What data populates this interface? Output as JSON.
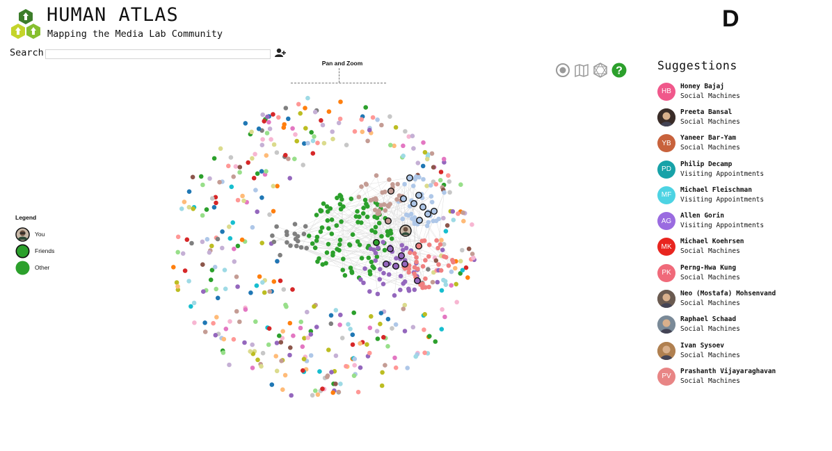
{
  "header": {
    "title": "HUMAN ATLAS",
    "subtitle": "Mapping the Media Lab Community",
    "brand_letter": "D"
  },
  "search": {
    "label": "Search",
    "value": "",
    "placeholder": ""
  },
  "panzoom": {
    "label": "Pan and Zoom"
  },
  "toolbar": {
    "icons": [
      "target-icon",
      "map-icon",
      "network-icon",
      "help-icon"
    ],
    "help_color": "#2ca02c"
  },
  "legend": {
    "title": "Legend",
    "items": [
      {
        "label": "You",
        "style": "photo"
      },
      {
        "label": "Friends",
        "color": "#2ca02c",
        "outline": true
      },
      {
        "label": "Other",
        "color": "#2ca02c",
        "outline": false
      }
    ]
  },
  "suggestions": {
    "title": "Suggestions",
    "items": [
      {
        "initials": "HB",
        "name": "Honey Bajaj",
        "group": "Social Machines",
        "color": "#f0588b",
        "photo": false
      },
      {
        "initials": "",
        "name": "Preeta Bansal",
        "group": "Social Machines",
        "color": "#3a2c28",
        "photo": true
      },
      {
        "initials": "YB",
        "name": "Yaneer Bar-Yam",
        "group": "Social Machines",
        "color": "#c8623c",
        "photo": false
      },
      {
        "initials": "PD",
        "name": "Philip Decamp",
        "group": "Visiting Appointments",
        "color": "#17a2a8",
        "photo": false
      },
      {
        "initials": "MF",
        "name": "Michael Fleischman",
        "group": "Visiting Appointments",
        "color": "#4dd3e3",
        "photo": false
      },
      {
        "initials": "AG",
        "name": "Allen Gorin",
        "group": "Visiting Appointments",
        "color": "#9a6be0",
        "photo": false
      },
      {
        "initials": "MK",
        "name": "Michael Koehrsen",
        "group": "Social Machines",
        "color": "#e8251f",
        "photo": false
      },
      {
        "initials": "PK",
        "name": "Perng-Hwa Kung",
        "group": "Social Machines",
        "color": "#f06a7a",
        "photo": false
      },
      {
        "initials": "",
        "name": "Neo (Mostafa) Mohsenvand",
        "group": "Social Machines",
        "color": "#6a5a50",
        "photo": true
      },
      {
        "initials": "",
        "name": "Raphael Schaad",
        "group": "Social Machines",
        "color": "#7a8a98",
        "photo": true
      },
      {
        "initials": "",
        "name": "Ivan Sysoev",
        "group": "Social Machines",
        "color": "#b08050",
        "photo": true
      },
      {
        "initials": "PV",
        "name": "Prashanth Vijayaraghavan",
        "group": "Social Machines",
        "color": "#e88585",
        "photo": false
      }
    ]
  },
  "graph": {
    "palette": [
      "#1f77b4",
      "#ff7f0e",
      "#2ca02c",
      "#d62728",
      "#9467bd",
      "#8c564b",
      "#e377c2",
      "#7f7f7f",
      "#bcbd22",
      "#17becf",
      "#aec7e8",
      "#ffbb78",
      "#98df8a",
      "#ff9896",
      "#c5b0d5",
      "#c49c94",
      "#f7b6d2",
      "#c7c7c7",
      "#dbdb8d",
      "#9edae5"
    ],
    "cluster_colors": {
      "green": "#2ca02c",
      "purple": "#9467bd",
      "salmon": "#f08080",
      "lightblue": "#aec7e8",
      "brown": "#c49c94",
      "gray": "#7f7f7f"
    }
  }
}
